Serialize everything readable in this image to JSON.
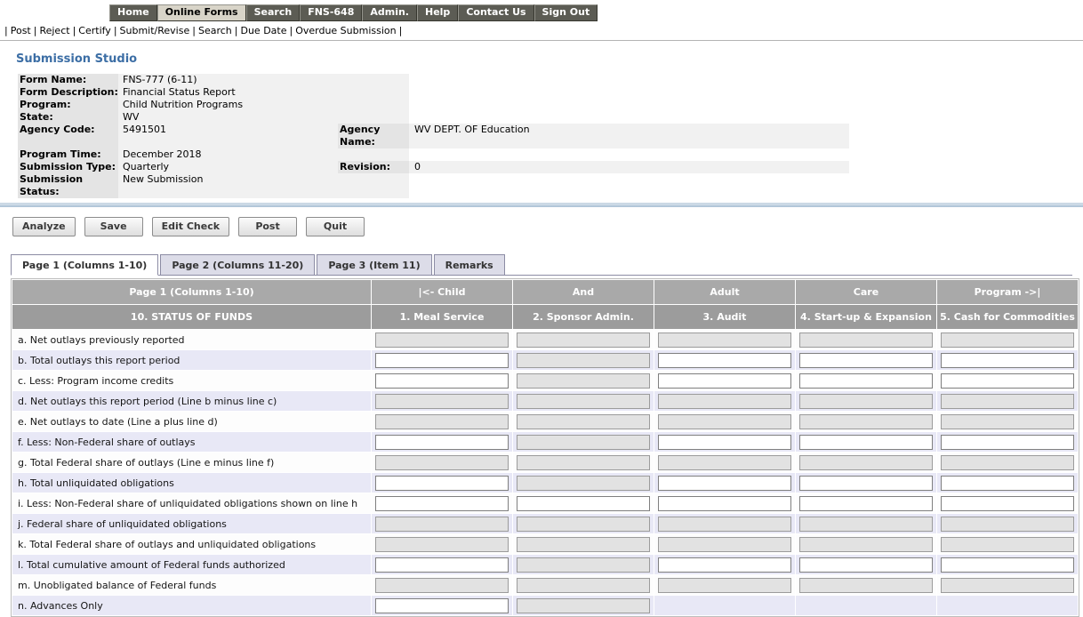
{
  "colors": {
    "nav_bg": "#5c5c54",
    "nav_active_bg": "#d8d4c8",
    "title_color": "#3c6ea5",
    "header_gray_1": "#a9a9a9",
    "header_gray_2": "#9c9c9c",
    "row_stripe": "#e8e8f6",
    "divider_blue": "#a9c0d4"
  },
  "topnav": {
    "items": [
      {
        "label": "Home",
        "active": false
      },
      {
        "label": "Online Forms",
        "active": true
      },
      {
        "label": "Search",
        "active": false
      },
      {
        "label": "FNS-648",
        "active": false
      },
      {
        "label": "Admin.",
        "active": false
      },
      {
        "label": "Help",
        "active": false
      },
      {
        "label": "Contact Us",
        "active": false
      },
      {
        "label": "Sign Out",
        "active": false
      }
    ]
  },
  "menubar": {
    "separator": "|",
    "items": [
      "Post",
      "Reject",
      "Certify",
      "Submit/Revise",
      "Search",
      "Due Date",
      "Overdue Submission"
    ]
  },
  "page_title": "Submission Studio",
  "form_info": {
    "rows": [
      {
        "label": "Form Name:",
        "value": "FNS-777 (6-11)"
      },
      {
        "label": "Form Description:",
        "value": "Financial Status Report"
      },
      {
        "label": "Program:",
        "value": "Child Nutrition Programs"
      },
      {
        "label": "State:",
        "value": "WV"
      },
      {
        "label": "Agency Code:",
        "value": "5491501",
        "label2": "Agency Name:",
        "value2": "WV DEPT. OF Education"
      },
      {
        "label": "Program Time:",
        "value": "December 2018"
      },
      {
        "label": "Submission Type:",
        "value": "Quarterly",
        "label2": "Revision:",
        "value2": "0"
      },
      {
        "label": "Submission Status:",
        "value": "New Submission"
      }
    ]
  },
  "toolbar": {
    "buttons": [
      "Analyze",
      "Save",
      "Edit Check",
      "Post",
      "Quit"
    ]
  },
  "tabs": [
    {
      "label": "Page 1 (Columns 1-10)",
      "active": true
    },
    {
      "label": "Page 2 (Columns 11-20)",
      "active": false
    },
    {
      "label": "Page 3 (Item 11)",
      "active": false
    },
    {
      "label": "Remarks",
      "active": false
    }
  ],
  "grid": {
    "header_row1": [
      "Page 1 (Columns 1-10)",
      "|<- Child",
      "And",
      "Adult",
      "Care",
      "Program ->|"
    ],
    "header_row2": [
      "10. STATUS OF FUNDS",
      "1. Meal Service",
      "2. Sponsor Admin.",
      "3. Audit",
      "4. Start-up & Expansion",
      "5. Cash for Commodities"
    ],
    "rows": [
      {
        "label": "a. Net outlays previously reported",
        "cells": [
          "readonly",
          "readonly",
          "readonly",
          "readonly",
          "readonly"
        ]
      },
      {
        "label": "b. Total outlays this report period",
        "cells": [
          "editable",
          "readonly",
          "editable",
          "editable",
          "editable"
        ]
      },
      {
        "label": "c. Less: Program income credits",
        "cells": [
          "editable",
          "readonly",
          "editable",
          "editable",
          "editable"
        ]
      },
      {
        "label": "d. Net outlays this report period (Line b minus line c)",
        "cells": [
          "readonly",
          "readonly",
          "readonly",
          "readonly",
          "readonly"
        ]
      },
      {
        "label": "e. Net outlays to date (Line a plus line d)",
        "cells": [
          "readonly",
          "readonly",
          "readonly",
          "readonly",
          "readonly"
        ]
      },
      {
        "label": "f. Less: Non-Federal share of outlays",
        "cells": [
          "editable",
          "readonly",
          "editable",
          "editable",
          "editable"
        ]
      },
      {
        "label": "g. Total Federal share of outlays (Line e minus line f)",
        "cells": [
          "readonly",
          "readonly",
          "readonly",
          "readonly",
          "readonly"
        ]
      },
      {
        "label": "h. Total unliquidated obligations",
        "cells": [
          "editable",
          "readonly",
          "editable",
          "editable",
          "editable"
        ]
      },
      {
        "label": "i. Less: Non-Federal share of unliquidated obligations shown on line h",
        "cells": [
          "editable",
          "editable",
          "editable",
          "editable",
          "editable"
        ]
      },
      {
        "label": "j. Federal share of unliquidated obligations",
        "cells": [
          "readonly",
          "readonly",
          "readonly",
          "readonly",
          "readonly"
        ]
      },
      {
        "label": "k. Total Federal share of outlays and unliquidated obligations",
        "cells": [
          "readonly",
          "readonly",
          "readonly",
          "readonly",
          "readonly"
        ]
      },
      {
        "label": "l. Total cumulative amount of Federal funds authorized",
        "cells": [
          "editable",
          "readonly",
          "editable",
          "editable",
          "editable"
        ]
      },
      {
        "label": "m. Unobligated balance of Federal funds",
        "cells": [
          "readonly",
          "readonly",
          "readonly",
          "readonly",
          "readonly"
        ]
      },
      {
        "label": "n. Advances Only",
        "cells": [
          "editable",
          "readonly",
          "none",
          "none",
          "none"
        ]
      }
    ]
  }
}
